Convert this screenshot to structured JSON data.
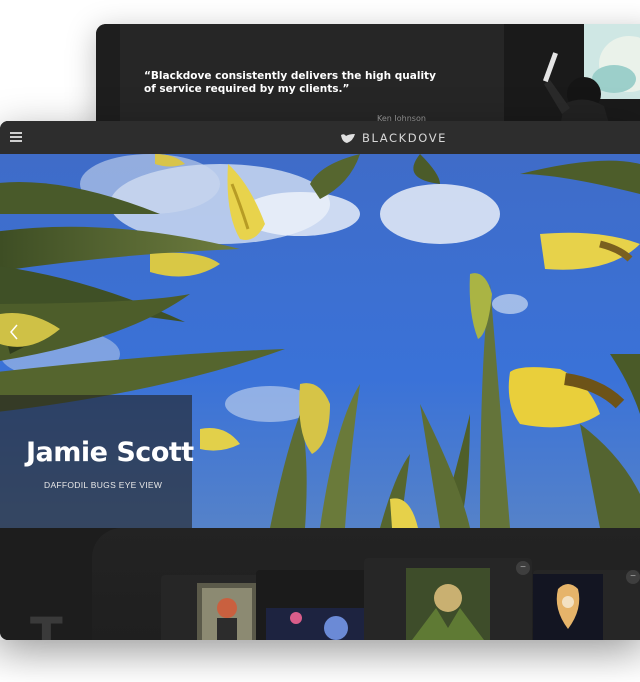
{
  "testimonial": {
    "quote": "“Blackdove consistently delivers the high quality of service required by my clients.”",
    "author": "Ken Johnson"
  },
  "header": {
    "brand": "BLACKDOVE",
    "menu_icon": "hamburger-menu-icon",
    "logo_icon": "dove-logo-icon"
  },
  "hero": {
    "artist": "Jamie Scott",
    "artwork_title": "DAFFODIL BUGS EYE VIEW",
    "prev_icon": "chevron-left-icon"
  },
  "tray": {
    "remove_icon": "minus-icon",
    "big_letter": "T"
  },
  "colors": {
    "sky": "#3a6fd6",
    "leaf": "#4a5a2c",
    "petal": "#e6d14a",
    "topbar": "#2d2d2d"
  }
}
